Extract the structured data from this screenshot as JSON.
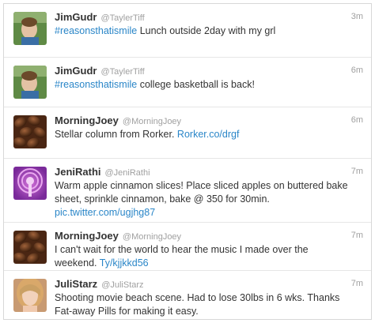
{
  "tweets": [
    {
      "name": "JimGudr",
      "handle": "@TaylerTiff",
      "time": "3m",
      "hashtag": "#reasonsthatismile",
      "text": " Lunch outside 2day with my grl",
      "link": "",
      "avatar_icon": "child-photo-avatar"
    },
    {
      "name": "JimGudr",
      "handle": "@TaylerTiff",
      "time": "6m",
      "hashtag": "#reasonsthatismile",
      "text": " college basketball is back!",
      "link": "",
      "avatar_icon": "child-photo-avatar"
    },
    {
      "name": "MorningJoey",
      "handle": "@MorningJoey",
      "time": "6m",
      "hashtag": "",
      "text": "Stellar column from Rorker. ",
      "link": "Rorker.co/drgf",
      "avatar_icon": "coffee-beans-avatar"
    },
    {
      "name": "JeniRathi",
      "handle": "@JeniRathi",
      "time": "7m",
      "hashtag": "",
      "text": "Warm apple cinnamon slices! Place sliced apples on buttered bake sheet, sprinkle cinnamon, bake @ 350 for 30min. ",
      "link": "pic.twitter.com/ugjhg87",
      "avatar_icon": "podcast-avatar"
    },
    {
      "name": "MorningJoey",
      "handle": "@MorningJoey",
      "time": "7m",
      "hashtag": "",
      "text": "I can't wait for the world to hear the music I made over the weekend. ",
      "link": "Ty/kjjkkd56",
      "avatar_icon": "coffee-beans-avatar"
    },
    {
      "name": "JuliStarz",
      "handle": "@JuliStarz",
      "time": "7m",
      "hashtag": "",
      "text": "Shooting movie beach scene. Had to lose 30lbs in 6 wks. Thanks Fat-away Pills for making it easy.",
      "link": "",
      "avatar_icon": "woman-photo-avatar"
    }
  ]
}
